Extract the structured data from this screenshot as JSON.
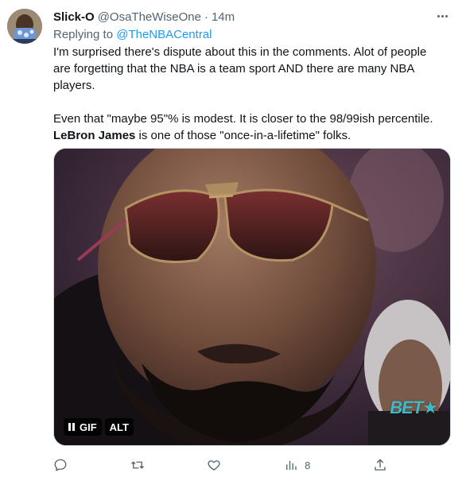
{
  "tweet": {
    "author": {
      "display_name": "Slick-O",
      "handle": "@OsaTheWiseOne",
      "separator": "·",
      "timestamp": "14m"
    },
    "reply_to": {
      "prefix": "Replying to ",
      "handle": "@TheNBACentral"
    },
    "body": {
      "line1": "I'm surprised there's dispute about this in the comments. Alot of people",
      "line2": "are forgetting that the NBA is a team sport AND there are many NBA",
      "line3": "players.",
      "line4": "Even that \"maybe 95\"% is modest. It is closer to the 98/99ish percentile.",
      "line5_bold": "LeBron James",
      "line5_rest": " is one of those \"once-in-a-lifetime\" folks."
    },
    "media": {
      "pause_label": "GIF",
      "alt_label": "ALT",
      "watermark": "BET★"
    },
    "actions": {
      "reply_icon": "reply-icon",
      "retweet_icon": "retweet-icon",
      "like_icon": "like-icon",
      "views_icon": "views-icon",
      "views_count": "8",
      "share_icon": "share-icon"
    },
    "colors": {
      "link": "#1d9bf0",
      "secondary_text": "#536471",
      "primary_text": "#0f1419"
    }
  }
}
